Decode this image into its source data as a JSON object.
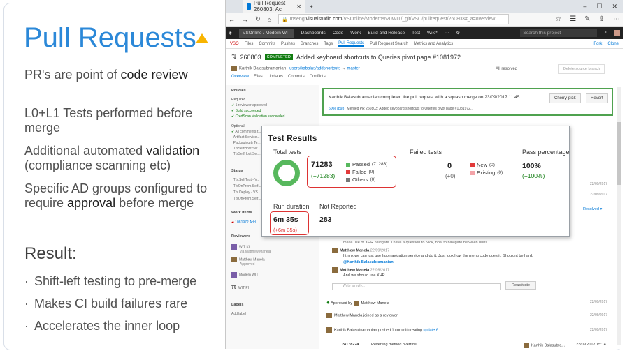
{
  "slide": {
    "title": "Pull Requests",
    "colors": {
      "title": "#2b88d8",
      "triangle": "#f8b400",
      "callout_red": "#dd3333",
      "passed_green": "#57b85d"
    },
    "lines": [
      {
        "pre": "PR's are point of ",
        "bold": "code review",
        "post": ""
      },
      {
        "pre": "L0+L1 Tests performed before merge",
        "bold": "",
        "post": ""
      },
      {
        "pre": "Additional automated ",
        "bold": "validation",
        "post": " (compliance scanning etc)"
      },
      {
        "pre": "Specific AD groups configured to require ",
        "bold": "approval",
        "post": " before merge"
      }
    ],
    "result_heading": "Result:",
    "bullets": [
      "Shift-left testing to pre-merge",
      "Makes CI build failures rare",
      "Accelerates the inner loop"
    ]
  },
  "browser": {
    "tab_title": "Pull Request 260803: Ac",
    "url_prefix": "mseng.",
    "url_domain": "visualstudio.com",
    "url_rest": "/VSOnline/Modern%20WIT/_git/VSO/pullrequest/260803#_a=overview",
    "nav": {
      "project": "VSOnline / Modern WIT",
      "items": [
        "Dashboards",
        "Code",
        "Work",
        "Build and Release",
        "Test",
        "Wiki*"
      ],
      "search_placeholder": "Search this project"
    },
    "subnav": {
      "repo": "VSO",
      "items": [
        "Files",
        "Commits",
        "Pushes",
        "Branches",
        "Tags",
        "Pull Requests",
        "Pull Request Search",
        "Metrics and Analytics"
      ],
      "right": [
        "Fork",
        "Clone"
      ]
    },
    "pr": {
      "id": "260803",
      "status": "COMPLETED",
      "title": "Added keyboard shortcuts to Queries pivot page #1081972",
      "author": "Karthik Balasubramanian",
      "source_branch": "users/kabalas/addshortcuts",
      "target_branch": "master",
      "all_resolved": "All resolved",
      "delete_button": "Delete source branch",
      "tabs": [
        "Overview",
        "Files",
        "Updates",
        "Commits",
        "Conflicts"
      ]
    },
    "sidebar": {
      "policies": "Policies",
      "required": "Required",
      "req_items": [
        "1 reviewer approved",
        "Build succeeded",
        "CredScan Validation succeeded"
      ],
      "optional": "Optional",
      "opt_items": [
        "All comments r...",
        "Artifact Service...",
        "Packaging & Te...",
        "TfsSelfHost Set...",
        "TfsSelfHost Set..."
      ],
      "status": "Status",
      "status_items": [
        "Tfs.SelfTest - V...",
        "TfsOnPrem.Self...",
        "Tfs.Deploy - VS...",
        "TfsOnPrem.Self..."
      ],
      "work_items": "Work Items",
      "work_item": "1081972 Add...",
      "reviewers": "Reviewers",
      "reviewer_list": [
        "WIT KL",
        "Matthew Manela",
        "Modern WIT",
        "WIT PI"
      ],
      "reviewer_notes": [
        "via Matthew Manela",
        "Approved"
      ],
      "labels": "Labels",
      "add_label": "Add label"
    },
    "completion": {
      "message": "Karthik Balasubramanian completed the pull request with a squash merge on 23/09/2017 11:45.",
      "commit": "600e7b9b",
      "merged_text": "Merged PR 260803: Added keyboard shortcuts to Queries pivot page #1081972...",
      "cherry_pick": "Cherry-pick",
      "revert": "Revert"
    },
    "discussion": {
      "truncated": "make use of XHR navigate. I have a question to Nick, how to navigate between hubs.",
      "c1_author": "Matthew Manela",
      "c1_date": "22/09/2017",
      "c1_text": "I think we can just use hub navigation service and do it. Just look how the menu code does it. Shouldnt be hard.",
      "c1_mention": "@Karthik Balasubramanian",
      "c2_author": "Matthew Manela",
      "c2_date": "22/09/2017",
      "c2_text": "And we should use XHR",
      "reply_placeholder": "Write a reply...",
      "reactivate": "Reactivate",
      "resolved": "Resolved",
      "approved": "Approved by",
      "approved_by": "Matthew Manela",
      "joined": "Matthew Manela joined as a reviewer",
      "pushed_pre": "Karthik Balasubramanian pushed 1 commit creating ",
      "pushed_link": "update 6",
      "commit_id": "24178224",
      "commit_msg": "Reverting method override",
      "commit_author": "Karthik Balasubra...",
      "commit_date": "22/09/2017 15:14",
      "dates": [
        "22/09/2017",
        "22/09/2017",
        "22/09/2017",
        "22/09/2017",
        "22/09/2017"
      ]
    }
  },
  "test_results": {
    "title": "Test Results",
    "total_label": "Total tests",
    "total": "71283",
    "total_delta": "(+71283)",
    "passed_label": "Passed",
    "passed_count": "(71283)",
    "failed_label": "Failed",
    "failed_count": "(0)",
    "others_label": "Others",
    "others_count": "(0)",
    "failed_tests_label": "Failed tests",
    "failed_tests": "0",
    "failed_tests_delta": "(+0)",
    "new_label": "New",
    "new_count": "(0)",
    "existing_label": "Existing",
    "existing_count": "(0)",
    "pass_pct_label": "Pass percentage",
    "pass_pct": "100%",
    "pass_pct_delta": "(+100%)",
    "run_duration_label": "Run duration",
    "run_duration": "6m 35s",
    "run_duration_delta": "(+6m 35s)",
    "not_reported_label": "Not Reported",
    "not_reported": "283"
  }
}
